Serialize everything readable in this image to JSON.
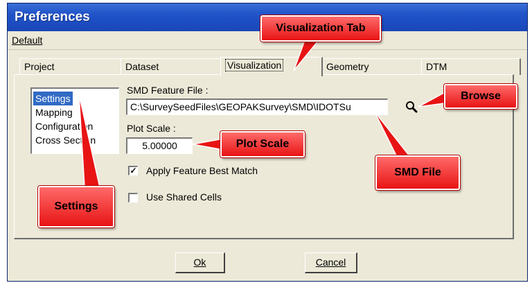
{
  "window": {
    "title": "Preferences"
  },
  "menu": {
    "default_label": "Default"
  },
  "tabs": [
    {
      "label": "Project"
    },
    {
      "label": "Dataset"
    },
    {
      "label": "Visualization"
    },
    {
      "label": "Geometry"
    },
    {
      "label": "DTM"
    }
  ],
  "active_tab": "Visualization",
  "settings_list": [
    "Settings",
    "Mapping",
    "Configuration",
    "Cross Section"
  ],
  "selected_setting": "Settings",
  "smd_feature_file": {
    "label": "SMD Feature File :",
    "value": "C:\\SurveySeedFiles\\GEOPAKSurvey\\SMD\\IDOTSu"
  },
  "plot_scale": {
    "label": "Plot Scale :",
    "value": "5.00000"
  },
  "options": {
    "apply_feature_best_match": {
      "label": "Apply Feature Best Match",
      "checked": true
    },
    "use_shared_cells": {
      "label": "Use Shared Cells",
      "checked": false
    }
  },
  "buttons": {
    "ok": "Ok",
    "cancel": "Cancel"
  },
  "callouts": {
    "visualization_tab": "Visualization Tab",
    "browse": "Browse",
    "plot_scale": "Plot Scale",
    "smd_file": "SMD File",
    "settings": "Settings"
  },
  "icons": {
    "browse": "magnifier-icon",
    "check": "checkmark-icon"
  },
  "colors": {
    "titlebar": "#2355c9",
    "selection": "#316ac5",
    "callout": "#e81414",
    "face": "#ece9d8"
  }
}
